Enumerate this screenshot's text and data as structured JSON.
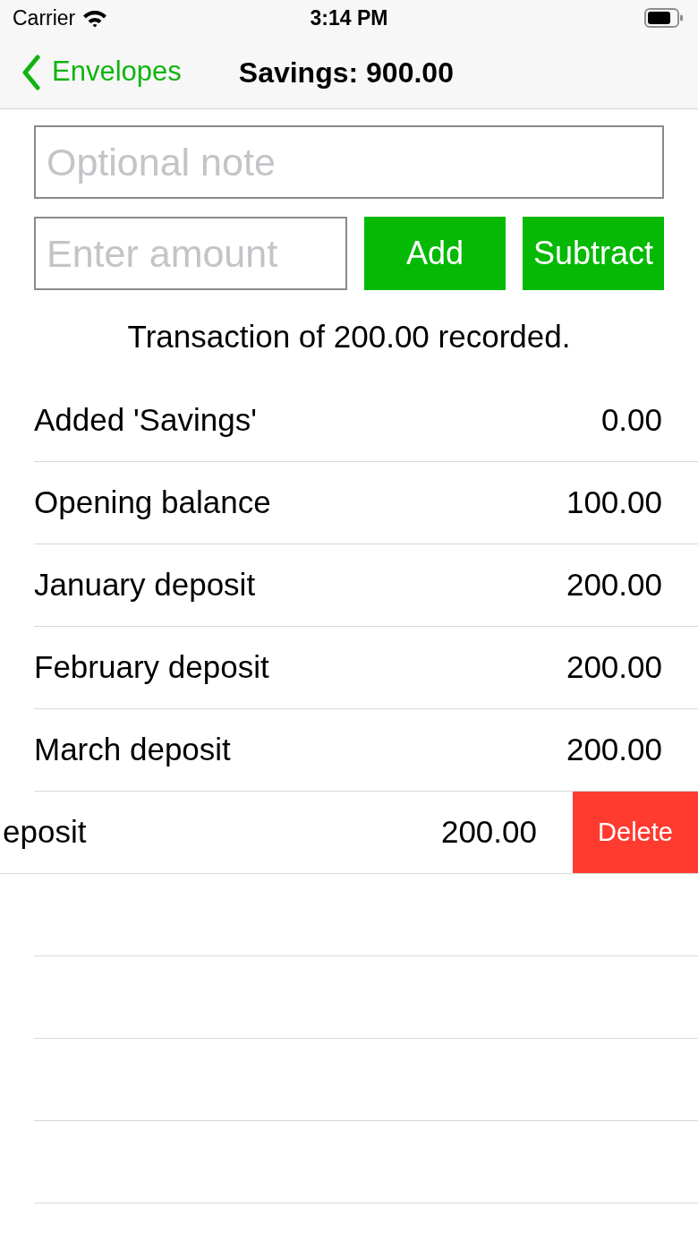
{
  "status_bar": {
    "carrier": "Carrier",
    "time": "3:14 PM"
  },
  "nav_bar": {
    "back_label": "Envelopes",
    "title": "Savings: 900.00"
  },
  "form": {
    "note_placeholder": "Optional note",
    "amount_placeholder": "Enter amount",
    "buttons": [
      {
        "label": "Add"
      },
      {
        "label": "Subtract"
      }
    ]
  },
  "message": "Transaction of 200.00 recorded.",
  "transactions": [
    {
      "label": "Added 'Savings'",
      "amount": "0.00",
      "swiped": false
    },
    {
      "label": "Opening balance",
      "amount": "100.00",
      "swiped": false
    },
    {
      "label": "January deposit",
      "amount": "200.00",
      "swiped": false
    },
    {
      "label": "February deposit",
      "amount": "200.00",
      "swiped": false
    },
    {
      "label": "March deposit",
      "amount": "200.00",
      "swiped": false
    },
    {
      "label": "eposit",
      "amount": "200.00",
      "swiped": true,
      "action": "Delete"
    }
  ]
}
